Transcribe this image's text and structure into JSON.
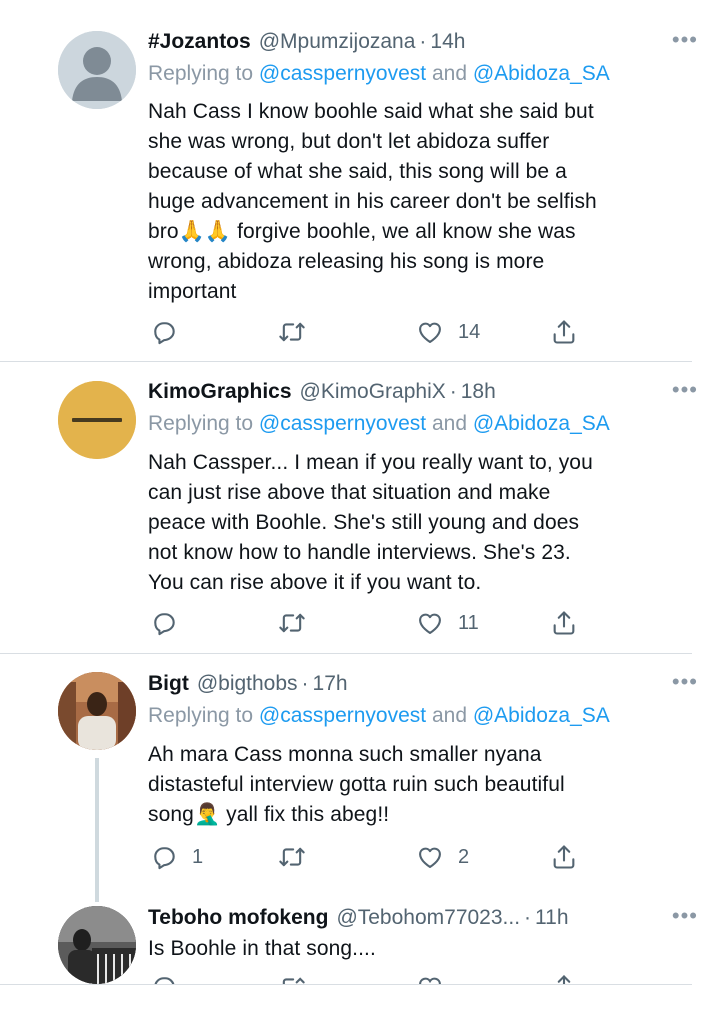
{
  "tweets": [
    {
      "name": "#Jozantos",
      "handle": "@Mpumzijozana",
      "dot": "·",
      "time": "14h",
      "more": "•••",
      "replying_prefix": "Replying to ",
      "replying_user1": "@casspernyovest",
      "replying_and": " and ",
      "replying_user2": "@Abidoza_SA",
      "body_lines": [
        "Nah Cass I know boohle said what she said but",
        "she was wrong, but don't let abidoza suffer",
        "because of what she said, this song will be a",
        "huge advancement in his career don't be selfish",
        "bro🙏🙏 forgive boohle, we all know she was",
        "wrong, abidoza releasing his song is more",
        "important"
      ],
      "reply_count": "",
      "retweet_count": "",
      "like_count": "14"
    },
    {
      "name": "KimoGraphics",
      "handle": "@KimoGraphiX",
      "dot": "·",
      "time": "18h",
      "more": "•••",
      "replying_prefix": "Replying to ",
      "replying_user1": "@casspernyovest",
      "replying_and": " and ",
      "replying_user2": "@Abidoza_SA",
      "body_lines": [
        "Nah Cassper... I mean if you really want to, you",
        "can just rise above that situation and make",
        "peace with Boohle. She's still young and does",
        "not know how to handle interviews. She's 23.",
        "You can rise above it if you want to."
      ],
      "reply_count": "",
      "retweet_count": "",
      "like_count": "11"
    },
    {
      "name": "Bigt",
      "handle": "@bigthobs",
      "dot": "·",
      "time": "17h",
      "more": "•••",
      "replying_prefix": "Replying to ",
      "replying_user1": "@casspernyovest",
      "replying_and": " and ",
      "replying_user2": "@Abidoza_SA",
      "body_lines": [
        "Ah mara Cass monna such smaller nyana",
        "distasteful interview gotta ruin such beautiful",
        "song🤦‍♂️ yall fix this abeg!!"
      ],
      "reply_count": "1",
      "retweet_count": "",
      "like_count": "2"
    },
    {
      "name": "Teboho mofokeng",
      "handle": "@Tebohom77023...",
      "dot": "·",
      "time": "11h",
      "more": "•••",
      "body_lines": [
        "Is Boohle in that song...."
      ]
    }
  ],
  "icons": {
    "reply": "reply-icon",
    "retweet": "retweet-icon",
    "like": "heart-icon",
    "share": "share-icon"
  },
  "colors": {
    "link": "#1d9bf0",
    "muted": "#536471",
    "text": "#0f1419",
    "kimo_avatar": "#e3b34c"
  }
}
